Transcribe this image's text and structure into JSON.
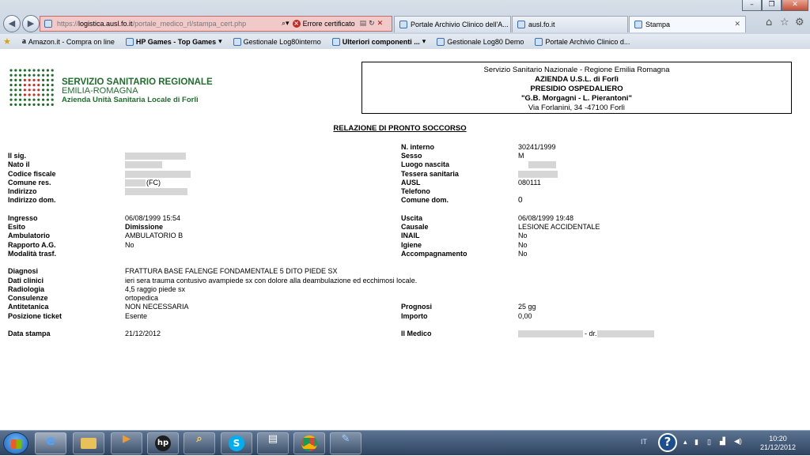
{
  "browser": {
    "url_prefix": "https://",
    "url_domain": "logistica.ausl.fo.it",
    "url_path": "/portale_medico_rl/stampa_cert.php",
    "cert_error": "Errore certificato",
    "tabs": [
      {
        "label": "Portale Archivio Clinico dell'A..."
      },
      {
        "label": "ausl.fo.it"
      },
      {
        "label": "Stampa"
      }
    ],
    "favorites": [
      {
        "label": "Amazon.it - Compra on line"
      },
      {
        "label": "HP Games - Top Games"
      },
      {
        "label": "Gestionale Log80interno"
      },
      {
        "label": "Ulteriori componenti ..."
      },
      {
        "label": "Gestionale Log80 Demo"
      },
      {
        "label": "Portale Archivio Clinico d..."
      }
    ]
  },
  "logo": {
    "line1": "SERVIZIO SANITARIO REGIONALE",
    "line2": "EMILIA-ROMAGNA",
    "line3": "Azienda Unità Sanitaria Locale di Forlì",
    "color": "#1f6e2d"
  },
  "header": {
    "line1": "Servizio Sanitario Nazionale - Regione Emilia Romagna",
    "line2": "AZIENDA U.S.L. di Forlì",
    "line3": "PRESIDIO OSPEDALIERO",
    "line4": "\"G.B. Morgagni - L. Pierantoni\"",
    "line5": "Via Forlanini, 34 -47100 Forlì"
  },
  "report": {
    "title": "RELAZIONE DI PRONTO SOCCORSO",
    "labels": {
      "sig": "Il sig.",
      "nato": "Nato il",
      "cf": "Codice fiscale",
      "comune": "Comune res.",
      "indirizzo": "Indirizzo",
      "indirizzo_dom": "Indirizzo dom.",
      "interno": "N. interno",
      "sesso": "Sesso",
      "luogo": "Luogo nascita",
      "tessera": "Tessera sanitaria",
      "ausl": "AUSL",
      "telefono": "Telefono",
      "comune_dom": "Comune dom.",
      "ingresso": "Ingresso",
      "esito": "Esito",
      "ambulatorio": "Ambulatorio",
      "rapporto": "Rapporto A.G.",
      "modalita": "Modalità trasf.",
      "uscita": "Uscita",
      "causale": "Causale",
      "inail": "INAIL",
      "igiene": "Igiene",
      "accompagnamento": "Accompagnamento",
      "diagnosi": "Diagnosi",
      "dati_clinici": "Dati clinici",
      "radiologia": "Radiologia",
      "consulenze": "Consulenze",
      "antitetanica": "Antitetanica",
      "ticket": "Posizione ticket",
      "prognosi": "Prognosi",
      "importo": "Importo",
      "data_stampa": "Data stampa",
      "medico": "Il Medico"
    },
    "values": {
      "comune": "(FC)",
      "interno": "30241/1999",
      "sesso": "M",
      "ausl": "080111",
      "comune_dom": "0",
      "ingresso": "06/08/1999 15:54",
      "esito": "Dimissione",
      "ambulatorio": "AMBULATORIO B",
      "rapporto": "No",
      "uscita": "06/08/1999 19:48",
      "causale": "LESIONE ACCIDENTALE",
      "inail": "No",
      "igiene": "No",
      "accompagnamento": "No",
      "diagnosi": "FRATTURA BASE FALENGE FONDAMENTALE 5 DITO PIEDE SX",
      "dati_clinici": "ieri sera trauma contusivo avampiede sx con dolore alla deambulazione ed ecchimosi locale.",
      "radiologia": "4,5 raggio piede sx",
      "consulenze": "ortopedica",
      "antitetanica": "NON NECESSARIA",
      "ticket": "Esente",
      "prognosi": "25 gg",
      "importo": "0,00",
      "data_stampa": "21/12/2012",
      "medico_sep": "- dr."
    }
  },
  "taskbar": {
    "lang": "IT",
    "time": "10:20",
    "date": "21/12/2012"
  }
}
